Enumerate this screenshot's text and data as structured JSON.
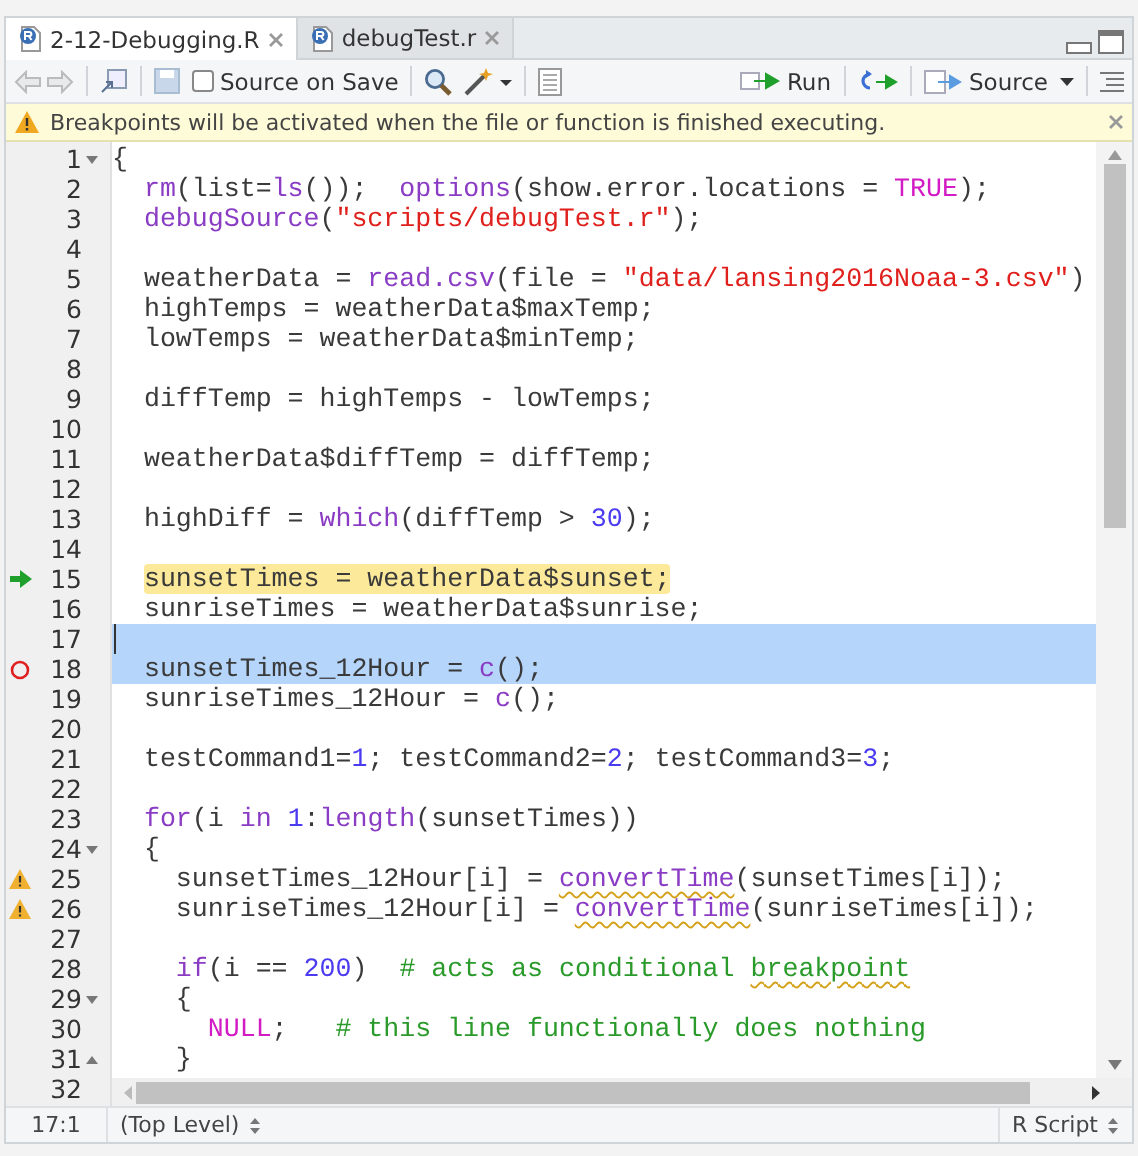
{
  "tabs": [
    {
      "label": "2-12-Debugging.R",
      "selected": true
    },
    {
      "label": "debugTest.r",
      "selected": false
    }
  ],
  "toolbar": {
    "source_on_save": {
      "label": "Source on Save",
      "checked": false
    },
    "run": "Run",
    "source": "Source"
  },
  "warning": "Breakpoints will be activated when the file or function is finished executing.",
  "lines": [
    {
      "number": "1",
      "fold_start": true,
      "selected": false,
      "tokens": [
        {
          "kind": "plain",
          "text": "{"
        }
      ]
    },
    {
      "number": "2",
      "selected": false,
      "tokens": [
        {
          "kind": "fn",
          "text": "  rm"
        },
        {
          "kind": "plain",
          "text": "(list="
        },
        {
          "kind": "fn",
          "text": "ls"
        },
        {
          "kind": "plain",
          "text": "());  "
        },
        {
          "kind": "fn",
          "text": "options"
        },
        {
          "kind": "plain",
          "text": "(show.error.locations = "
        },
        {
          "kind": "const",
          "text": "TRUE"
        },
        {
          "kind": "plain",
          "text": ");"
        }
      ]
    },
    {
      "number": "3",
      "selected": false,
      "tokens": [
        {
          "kind": "fn",
          "text": "  debugSource"
        },
        {
          "kind": "plain",
          "text": "("
        },
        {
          "kind": "str",
          "text": "\"scripts/debugTest.r\""
        },
        {
          "kind": "plain",
          "text": ");"
        }
      ]
    },
    {
      "number": "4",
      "selected": false
    },
    {
      "number": "5",
      "selected": false,
      "tokens": [
        {
          "kind": "plain",
          "text": "  weatherData = "
        },
        {
          "kind": "fn",
          "text": "read.csv"
        },
        {
          "kind": "plain",
          "text": "(file = "
        },
        {
          "kind": "str",
          "text": "\"data/lansing2016Noaa-3.csv\""
        },
        {
          "kind": "plain",
          "text": ")"
        }
      ]
    },
    {
      "number": "6",
      "selected": false,
      "tokens": [
        {
          "kind": "plain",
          "text": "  highTemps = weatherData$maxTemp;"
        }
      ]
    },
    {
      "number": "7",
      "selected": false,
      "tokens": [
        {
          "kind": "plain",
          "text": "  lowTemps = weatherData$minTemp;"
        }
      ]
    },
    {
      "number": "8",
      "selected": false
    },
    {
      "number": "9",
      "selected": false,
      "tokens": [
        {
          "kind": "plain",
          "text": "  diffTemp = highTemps - lowTemps;"
        }
      ]
    },
    {
      "number": "10",
      "selected": false
    },
    {
      "number": "11",
      "selected": false,
      "tokens": [
        {
          "kind": "plain",
          "text": "  weatherData$diffTemp = diffTemp;"
        }
      ]
    },
    {
      "number": "12",
      "selected": false
    },
    {
      "number": "13",
      "selected": false,
      "tokens": [
        {
          "kind": "plain",
          "text": "  highDiff = "
        },
        {
          "kind": "fn",
          "text": "which"
        },
        {
          "kind": "plain",
          "text": "(diffTemp > "
        },
        {
          "kind": "num",
          "text": "30"
        },
        {
          "kind": "plain",
          "text": ");"
        }
      ]
    },
    {
      "number": "14",
      "selected": false
    },
    {
      "number": "15",
      "execution_point": true,
      "selected": false,
      "tokens": [
        {
          "kind": "current",
          "text": "  sunsetTimes = weatherData$sunset;"
        }
      ]
    },
    {
      "number": "16",
      "selected": false,
      "tokens": [
        {
          "kind": "plain",
          "text": "  sunriseTimes = weatherData$sunrise;"
        }
      ]
    },
    {
      "number": "17",
      "selected": true,
      "cursor": true
    },
    {
      "number": "18",
      "breakpoint": true,
      "selected": true,
      "tokens": [
        {
          "kind": "plain",
          "text": "  sunsetTimes_12Hour = "
        },
        {
          "kind": "fn",
          "text": "c"
        },
        {
          "kind": "plain",
          "text": "();"
        }
      ]
    },
    {
      "number": "19",
      "selected": false,
      "tokens": [
        {
          "kind": "plain",
          "text": "  sunriseTimes_12Hour = "
        },
        {
          "kind": "fn",
          "text": "c"
        },
        {
          "kind": "plain",
          "text": "();"
        }
      ]
    },
    {
      "number": "20",
      "selected": false
    },
    {
      "number": "21",
      "selected": false,
      "tokens": [
        {
          "kind": "plain",
          "text": "  testCommand1="
        },
        {
          "kind": "num",
          "text": "1"
        },
        {
          "kind": "plain",
          "text": "; testCommand2="
        },
        {
          "kind": "num",
          "text": "2"
        },
        {
          "kind": "plain",
          "text": "; testCommand3="
        },
        {
          "kind": "num",
          "text": "3"
        },
        {
          "kind": "plain",
          "text": ";"
        }
      ]
    },
    {
      "number": "22",
      "selected": false
    },
    {
      "number": "23",
      "selected": false,
      "tokens": [
        {
          "kind": "fn",
          "text": "  for"
        },
        {
          "kind": "plain",
          "text": "(i "
        },
        {
          "kind": "fn",
          "text": "in "
        },
        {
          "kind": "num",
          "text": "1"
        },
        {
          "kind": "plain",
          "text": ":"
        },
        {
          "kind": "fn",
          "text": "length"
        },
        {
          "kind": "plain",
          "text": "(sunsetTimes))"
        }
      ]
    },
    {
      "number": "24",
      "fold_start": true,
      "selected": false,
      "tokens": [
        {
          "kind": "plain",
          "text": "  {"
        }
      ]
    },
    {
      "number": "25",
      "warning": true,
      "selected": false,
      "tokens": [
        {
          "kind": "plain",
          "text": "    sunsetTimes_12Hour[i] = "
        },
        {
          "kind": "fn-flagged",
          "text": "convertTime"
        },
        {
          "kind": "plain",
          "text": "(sunsetTimes[i]);"
        }
      ]
    },
    {
      "number": "26",
      "warning": true,
      "selected": false,
      "tokens": [
        {
          "kind": "plain",
          "text": "    sunriseTimes_12Hour[i] = "
        },
        {
          "kind": "fn-flagged",
          "text": "convertTime"
        },
        {
          "kind": "plain",
          "text": "(sunriseTimes[i]);"
        }
      ]
    },
    {
      "number": "27",
      "selected": false
    },
    {
      "number": "28",
      "selected": false,
      "tokens": [
        {
          "kind": "fn",
          "text": "    if"
        },
        {
          "kind": "plain",
          "text": "(i == "
        },
        {
          "kind": "num",
          "text": "200"
        },
        {
          "kind": "plain",
          "text": ")  "
        },
        {
          "kind": "comment",
          "text": "# acts as conditional "
        },
        {
          "kind": "comment-flagged",
          "text": "breakpoint"
        }
      ]
    },
    {
      "number": "29",
      "fold_start": true,
      "selected": false,
      "tokens": [
        {
          "kind": "plain",
          "text": "    {"
        }
      ]
    },
    {
      "number": "30",
      "selected": false,
      "tokens": [
        {
          "kind": "const",
          "text": "      NULL"
        },
        {
          "kind": "plain",
          "text": ";   "
        },
        {
          "kind": "comment",
          "text": "# this line functionally does nothing"
        }
      ]
    },
    {
      "number": "31",
      "fold_end": true,
      "selected": false,
      "tokens": [
        {
          "kind": "plain",
          "text": "    }"
        }
      ]
    },
    {
      "number": "32",
      "selected": false
    }
  ],
  "status_bar": {
    "position": "17:1",
    "scope": "(Top Level)",
    "file_type": "R Script"
  }
}
